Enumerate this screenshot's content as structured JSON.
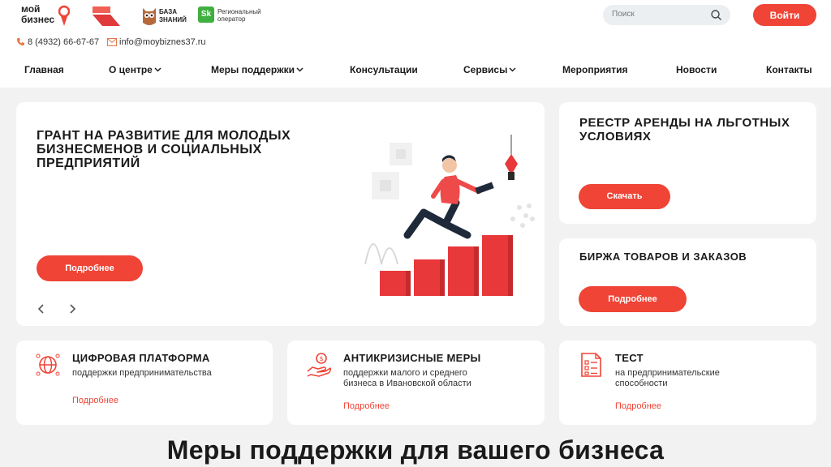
{
  "header": {
    "logo_moy_line1": "мой",
    "logo_moy_line2": "бизнес",
    "logo_baza_line1": "БАЗА",
    "logo_baza_line2": "ЗНАНИЙ",
    "logo_sk_box": "Sk",
    "logo_sk_line1": "Региональный",
    "logo_sk_line2": "оператор",
    "search_placeholder": "Поиск",
    "login_label": "Войти",
    "phone": "8 (4932) 66-67-67",
    "email": "info@moybiznes37.ru"
  },
  "nav": {
    "items": [
      {
        "label": "Главная"
      },
      {
        "label": "О центре"
      },
      {
        "label": "Меры поддержки"
      },
      {
        "label": "Консультации"
      },
      {
        "label": "Сервисы"
      },
      {
        "label": "Мероприятия"
      },
      {
        "label": "Новости"
      },
      {
        "label": "Контакты"
      }
    ]
  },
  "hero": {
    "title": "ГРАНТ НА РАЗВИТИЕ ДЛЯ МОЛОДЫХ БИЗНЕСМЕНОВ И СОЦИАЛЬНЫХ ПРЕДПРИЯТИЙ",
    "button": "Подробнее"
  },
  "side": [
    {
      "title": "РЕЕСТР АРЕНДЫ НА ЛЬГОТНЫХ УСЛОВИЯХ",
      "button": "Скачать"
    },
    {
      "title": "БИРЖА ТОВАРОВ И ЗАКАЗОВ",
      "button": "Подробнее"
    }
  ],
  "cards": [
    {
      "title": "ЦИФРОВАЯ ПЛАТФОРМА",
      "desc": "поддержки предпринимательства",
      "link": "Подробнее",
      "icon": "globe-network-icon"
    },
    {
      "title": "АНТИКРИЗИСНЫЕ МЕРЫ",
      "desc": "поддержки малого и среднего бизнеса в Ивановской области",
      "link": "Подробнее",
      "icon": "hand-coin-icon"
    },
    {
      "title": "ТЕСТ",
      "desc": "на предпринимательские способности",
      "link": "Подробнее",
      "icon": "checklist-icon"
    }
  ],
  "section_title": "Меры поддержки для вашего бизнеса",
  "colors": {
    "accent": "#ef4436",
    "background": "#f2f2f2",
    "card": "#ffffff"
  }
}
